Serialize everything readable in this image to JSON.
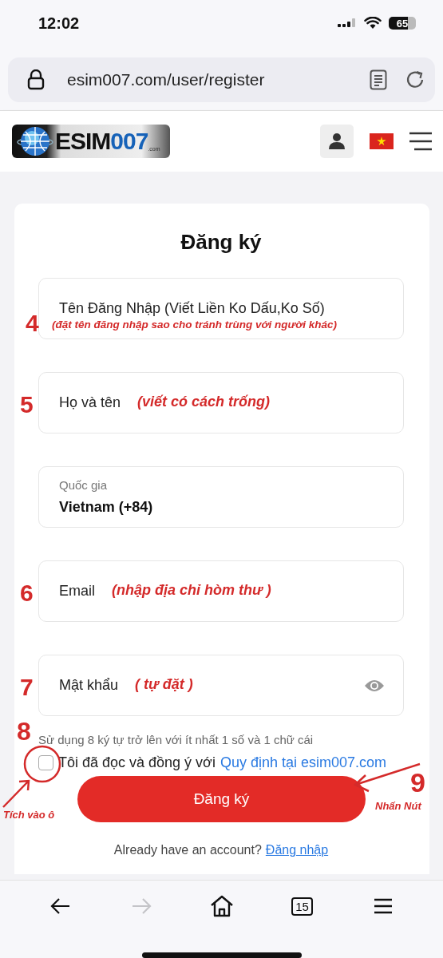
{
  "status_bar": {
    "time": "12:02",
    "battery": "65"
  },
  "address_bar": {
    "url": "esim007.com/user/register"
  },
  "site_header": {
    "logo": {
      "word": "ESIM",
      "number": "007",
      "suffix": ".com"
    }
  },
  "form": {
    "title": "Đăng ký",
    "fields": [
      {
        "kind": "text",
        "placeholder": "Tên Đăng Nhập (Viết Liền Ko Dấu,Ko Số)",
        "annotation": {
          "number": "4",
          "note": "(đặt tên đăng nhập sao cho tránh trùng với người khác)"
        }
      },
      {
        "kind": "text",
        "placeholder": "Họ và tên",
        "annotation": {
          "number": "5",
          "note": "(viết có cách trống)"
        }
      },
      {
        "kind": "select",
        "label": "Quốc gia",
        "value": "Vietnam (+84)"
      },
      {
        "kind": "text",
        "placeholder": "Email",
        "annotation": {
          "number": "6",
          "note": "(nhập địa chỉ hòm thư )"
        }
      },
      {
        "kind": "password",
        "placeholder": "Mật khẩu",
        "annotation": {
          "number": "7",
          "note": "( tự đặt )"
        }
      }
    ],
    "password_hint": "Sử dụng 8 ký tự trở lên với ít nhất 1 số và 1 chữ cái",
    "agreement": {
      "checked": false,
      "text": "Tôi đã đọc và đồng ý với",
      "link": "Quy định tại esim007.com",
      "annotation": {
        "number": "8",
        "note": "Tích vào ô"
      }
    },
    "submit": {
      "label": "Đăng ký",
      "annotation": {
        "number": "9",
        "note": "Nhấn Nút"
      }
    },
    "login_prompt": {
      "text": "Already have an account?",
      "link": "Đăng nhập"
    }
  },
  "toolbar": {
    "items": [
      {
        "kind": "back",
        "disabled": false
      },
      {
        "kind": "forward",
        "disabled": true
      },
      {
        "kind": "home",
        "disabled": false
      },
      {
        "kind": "tabs",
        "disabled": false,
        "count": "15"
      },
      {
        "kind": "menu",
        "disabled": false
      }
    ]
  }
}
